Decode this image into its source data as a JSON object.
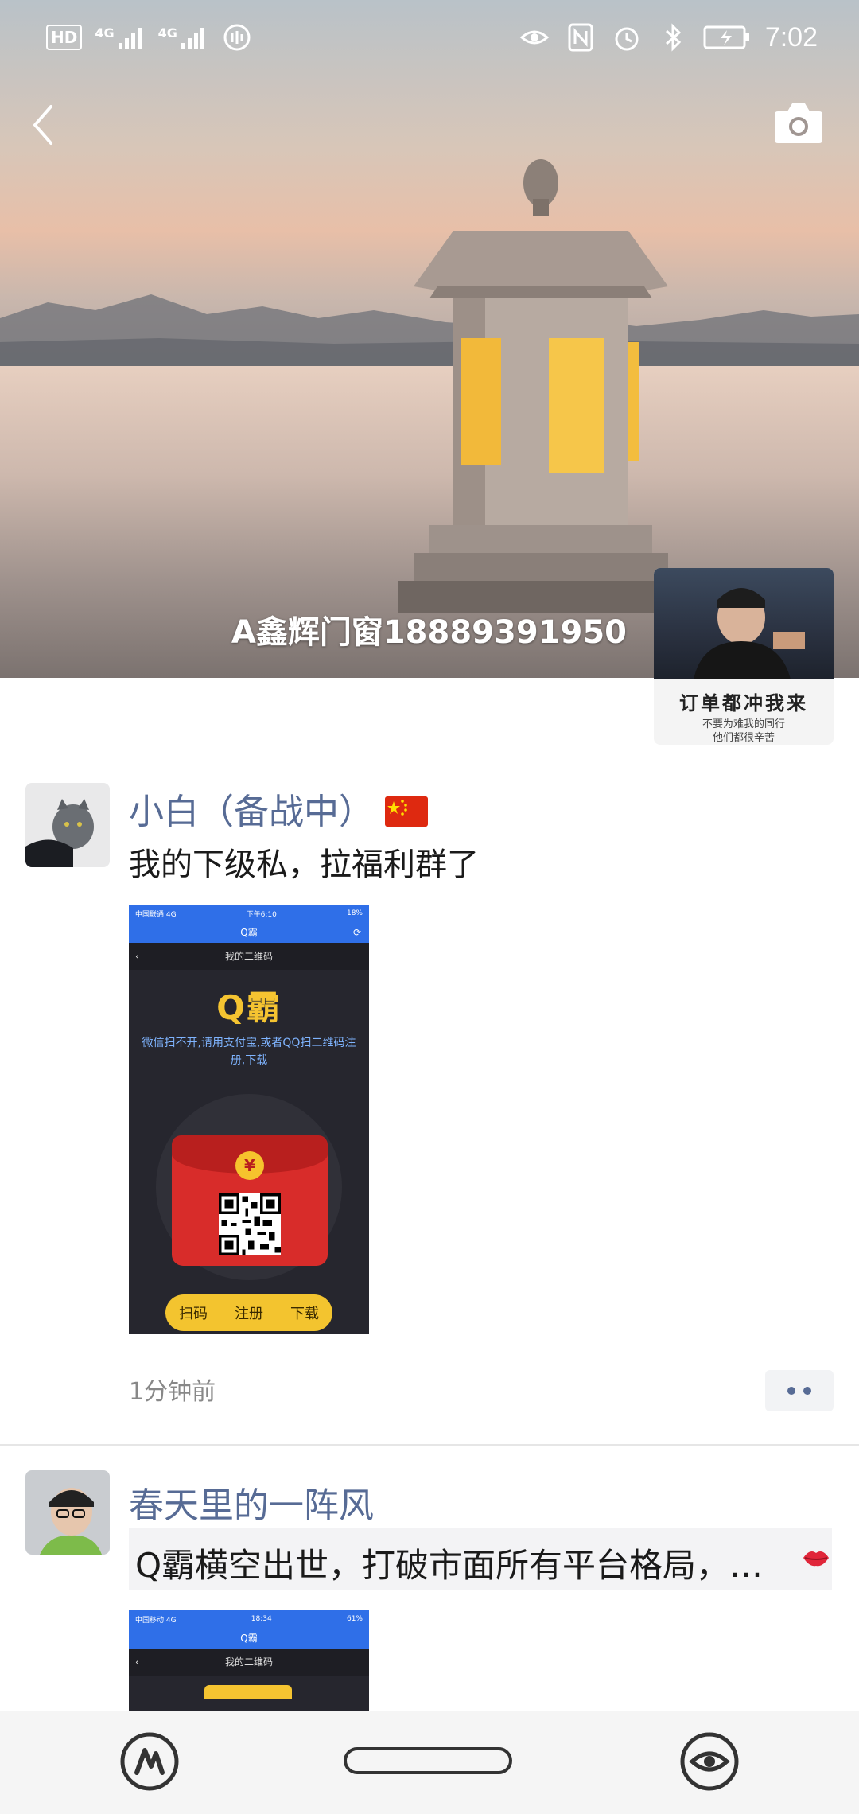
{
  "status_bar": {
    "hd": "HD",
    "net1": "4G",
    "net2": "4G",
    "time": "7:02"
  },
  "header": {
    "profile_name": "A鑫辉门窗18889391950",
    "avatar_caption": "订单都冲我来",
    "avatar_subcaption_1": "不要为难我的同行",
    "avatar_subcaption_2": "他们都很辛苦"
  },
  "posts": [
    {
      "author": "小白（备战中）",
      "text": "我的下级私，拉福利群了",
      "image": {
        "carrier": "中国联通 4G",
        "clock": "下午6:10",
        "battery": "18%",
        "app_title": "Q霸",
        "sub_title": "我的二维码",
        "brand": "Q霸",
        "hint": "微信扫不开,请用支付宝,或者QQ扫二维码注册,下载",
        "coin": "¥",
        "buttons": [
          "扫码",
          "注册",
          "下载"
        ]
      },
      "time": "1分钟前"
    },
    {
      "author": "春天里的一阵风",
      "text": "Q霸横空出世，打破市面所有平台格局，…",
      "image": {
        "carrier": "中国移动 4G",
        "clock": "18:34",
        "battery": "61%",
        "app_title": "Q霸",
        "sub_title": "我的二维码"
      }
    }
  ],
  "colors": {
    "author_blue": "#576b95",
    "brand_gold": "#f5c431",
    "envelope_red": "#d82c2a"
  },
  "icons": {
    "back": "back-arrow-icon",
    "camera": "camera-icon",
    "flag": "china-flag-icon"
  }
}
